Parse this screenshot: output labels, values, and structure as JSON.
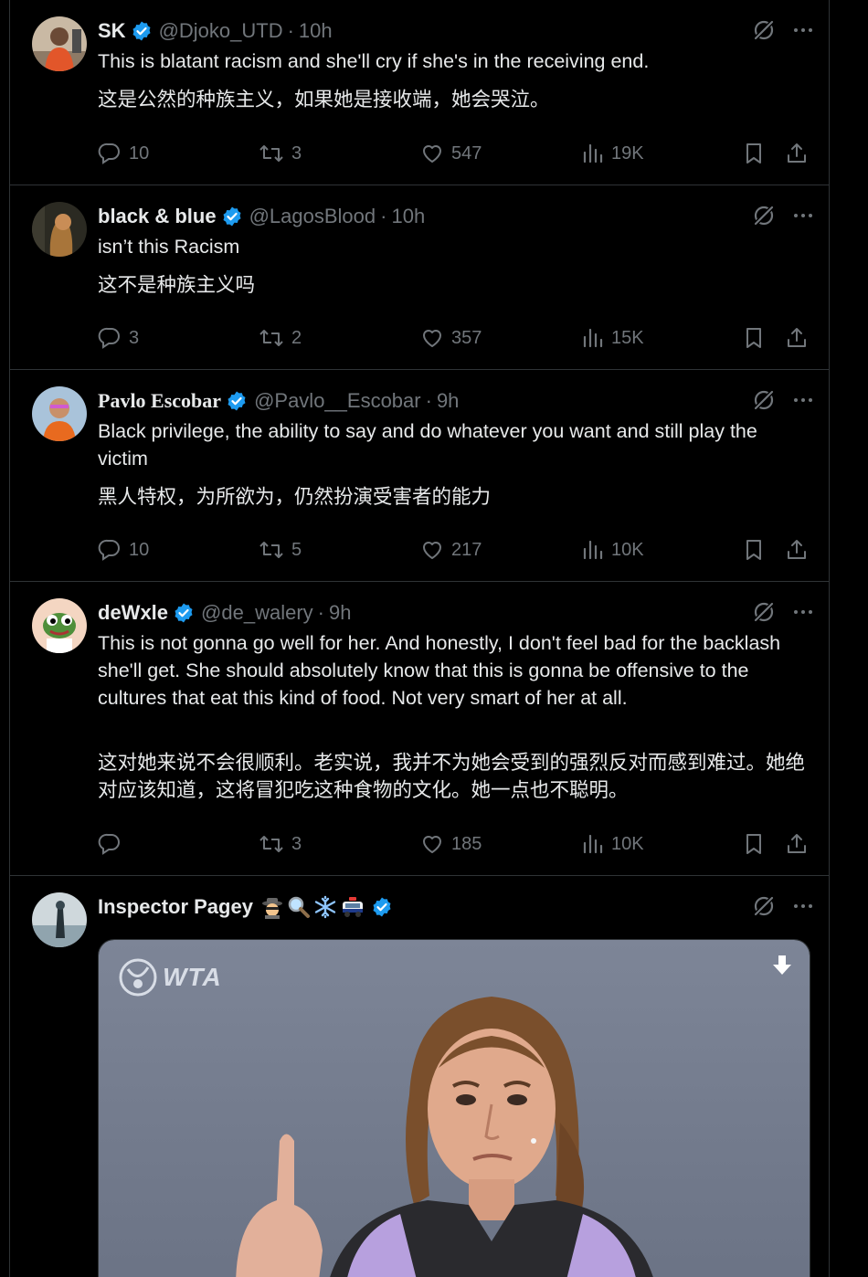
{
  "tweets": [
    {
      "name": "SK",
      "handle": "@Djoko_UTD",
      "time": "10h",
      "text": "This is blatant racism and she'll cry if she's in the receiving end.",
      "translation": "这是公然的种族主义，如果她是接收端，她会哭泣。",
      "replies": "10",
      "reposts": "3",
      "likes": "547",
      "views": "19K"
    },
    {
      "name": "black & blue",
      "handle": "@LagosBlood",
      "time": "10h",
      "text": "isn’t this Racism",
      "translation": "这不是种族主义吗",
      "replies": "3",
      "reposts": "2",
      "likes": "357",
      "views": "15K"
    },
    {
      "name": "Pavlo Escobar",
      "handle": "@Pavlo__Escobar",
      "time": "9h",
      "text": "Black privilege, the ability to say and do whatever you want and still play the victim",
      "translation": "黑人特权，为所欲为，仍然扮演受害者的能力",
      "replies": "10",
      "reposts": "5",
      "likes": "217",
      "views": "10K"
    },
    {
      "name": "deWxle",
      "handle": "@de_walery",
      "time": "9h",
      "text": "This is not gonna go well for her. And honestly, I don't feel bad for the backlash she'll get. She should absolutely know that this is gonna be offensive to the cultures that eat this kind of food. Not very smart of her at all.",
      "translation": "这对她来说不会很顺利。老实说，我并不为她会受到的强烈反对而感到难过。她绝对应该知道，这将冒犯吃这种食物的文化。她一点也不聪明。",
      "replies": "",
      "reposts": "3",
      "likes": "185",
      "views": "10K"
    },
    {
      "name": "Inspector Pagey",
      "name_emojis": [
        "detective-emoji",
        "magnifier-emoji",
        "snowflake-emoji",
        "police-car-emoji"
      ],
      "media_brand": "WTA"
    }
  ],
  "colors": {
    "background": "#000000",
    "text": "#e7e9ea",
    "muted": "#71767b",
    "divider": "#2f3336",
    "verified": "#1d9bf0"
  },
  "icons": {
    "verified": "verified-badge-icon",
    "grok": "grok-icon",
    "more": "more-icon",
    "reply": "reply-icon",
    "repost": "repost-icon",
    "like": "like-icon",
    "views": "views-icon",
    "bookmark": "bookmark-icon",
    "share": "share-icon",
    "download": "download-icon"
  }
}
